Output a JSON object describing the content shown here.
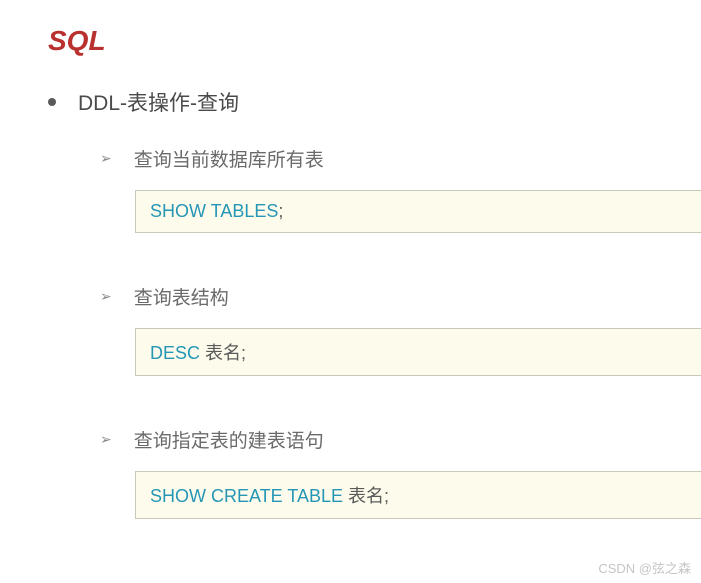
{
  "title": "SQL",
  "mainBullet": "DDL-表操作-查询",
  "sections": [
    {
      "heading": "查询当前数据库所有表",
      "code": {
        "keyword": "SHOW TABLES",
        "suffix": ";"
      }
    },
    {
      "heading": "查询表结构",
      "code": {
        "keyword": "DESC",
        "suffix": " 表名;"
      }
    },
    {
      "heading": "查询指定表的建表语句",
      "code": {
        "keyword": "SHOW CREATE TABLE",
        "suffix": " 表名;"
      }
    }
  ],
  "watermark": "CSDN @弦之森"
}
